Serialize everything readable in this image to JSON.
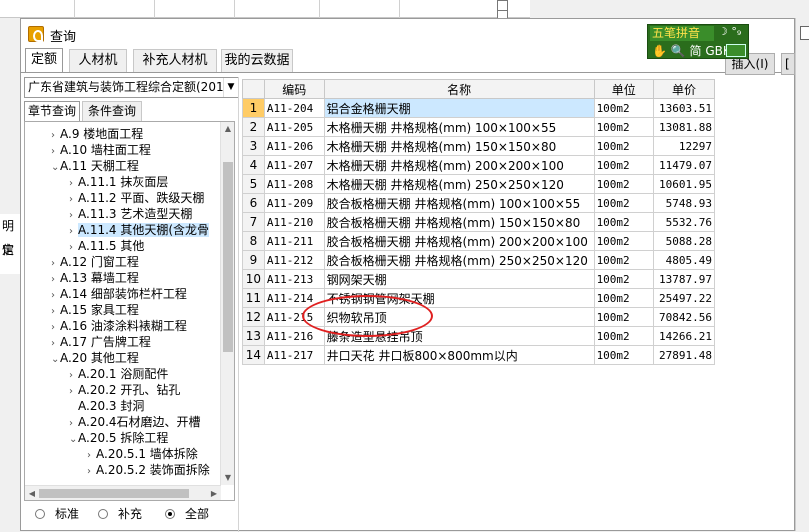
{
  "background": {
    "left_items": [
      "明信",
      "定"
    ]
  },
  "dialog": {
    "title": "查询",
    "tabs": [
      "定额",
      "人材机",
      "补充人材机",
      "我的云数据"
    ],
    "insert_label": "插入(I)",
    "insert_label2": "[",
    "ime": {
      "name": "五笔拼音",
      "moon": "☽ °₉",
      "row2": "✋ 🔍 简 GBK"
    },
    "library": "广东省建筑与装饰工程综合定额(201",
    "subtabs": [
      "章节查询",
      "条件查询"
    ],
    "tree": [
      {
        "label": "A.9 楼地面工程",
        "level": 1,
        "expanded": false
      },
      {
        "label": "A.10 墙柱面工程",
        "level": 1,
        "expanded": false
      },
      {
        "label": "A.11 天棚工程",
        "level": 1,
        "expanded": true
      },
      {
        "label": "A.11.1 抹灰面层",
        "level": 2,
        "expanded": false
      },
      {
        "label": "A.11.2 平面、跌级天棚",
        "level": 2,
        "expanded": false
      },
      {
        "label": "A.11.3 艺术造型天棚",
        "level": 2,
        "expanded": false
      },
      {
        "label": "A.11.4 其他天棚(含龙骨",
        "level": 2,
        "expanded": false,
        "selected": true
      },
      {
        "label": "A.11.5 其他",
        "level": 2,
        "expanded": false
      },
      {
        "label": "A.12 门窗工程",
        "level": 1,
        "expanded": false
      },
      {
        "label": "A.13 幕墙工程",
        "level": 1,
        "expanded": false
      },
      {
        "label": "A.14 细部装饰栏杆工程",
        "level": 1,
        "expanded": false
      },
      {
        "label": "A.15 家具工程",
        "level": 1,
        "expanded": false
      },
      {
        "label": "A.16 油漆涂料裱糊工程",
        "level": 1,
        "expanded": false
      },
      {
        "label": "A.17 广告牌工程",
        "level": 1,
        "expanded": false
      },
      {
        "label": "A.20 其他工程",
        "level": 1,
        "expanded": true
      },
      {
        "label": "A.20.1 浴厕配件",
        "level": 2,
        "expanded": false
      },
      {
        "label": "A.20.2 开孔、钻孔",
        "level": 2,
        "expanded": false
      },
      {
        "label": "A.20.3 封洞",
        "level": 2,
        "expanded": false,
        "leaf": true
      },
      {
        "label": "A.20.4石材磨边、开槽",
        "level": 2,
        "expanded": false
      },
      {
        "label": "A.20.5 拆除工程",
        "level": 2,
        "expanded": true
      },
      {
        "label": "A.20.5.1 墙体拆除",
        "level": 3,
        "expanded": false
      },
      {
        "label": "A.20.5.2 装饰面拆除",
        "level": 3,
        "expanded": false
      }
    ],
    "radios": [
      {
        "label": "标准",
        "checked": false
      },
      {
        "label": "补充",
        "checked": false
      },
      {
        "label": "全部",
        "checked": true
      }
    ],
    "table": {
      "headers": [
        "编码",
        "名称",
        "单位",
        "单价"
      ],
      "rows": [
        {
          "idx": "1",
          "code": "A11-204",
          "name": "铝合金格栅天棚",
          "unit": "100m2",
          "price": "13603.51",
          "selected": true
        },
        {
          "idx": "2",
          "code": "A11-205",
          "name": "木格栅天棚 井格规格(mm) 100×100×55",
          "unit": "100m2",
          "price": "13081.88"
        },
        {
          "idx": "3",
          "code": "A11-206",
          "name": "木格栅天棚 井格规格(mm) 150×150×80",
          "unit": "100m2",
          "price": "12297"
        },
        {
          "idx": "4",
          "code": "A11-207",
          "name": "木格栅天棚 井格规格(mm) 200×200×100",
          "unit": "100m2",
          "price": "11479.07"
        },
        {
          "idx": "5",
          "code": "A11-208",
          "name": "木格栅天棚 井格规格(mm) 250×250×120",
          "unit": "100m2",
          "price": "10601.95"
        },
        {
          "idx": "6",
          "code": "A11-209",
          "name": "胶合板格栅天棚 井格规格(mm) 100×100×55",
          "unit": "100m2",
          "price": "5748.93"
        },
        {
          "idx": "7",
          "code": "A11-210",
          "name": "胶合板格栅天棚 井格规格(mm) 150×150×80",
          "unit": "100m2",
          "price": "5532.76"
        },
        {
          "idx": "8",
          "code": "A11-211",
          "name": "胶合板格栅天棚 井格规格(mm) 200×200×100",
          "unit": "100m2",
          "price": "5088.28"
        },
        {
          "idx": "9",
          "code": "A11-212",
          "name": "胶合板格栅天棚 井格规格(mm) 250×250×120",
          "unit": "100m2",
          "price": "4805.49"
        },
        {
          "idx": "10",
          "code": "A11-213",
          "name": "钢网架天棚",
          "unit": "100m2",
          "price": "13787.97"
        },
        {
          "idx": "11",
          "code": "A11-214",
          "name": "不锈钢钢管网架天棚",
          "unit": "100m2",
          "price": "25497.22"
        },
        {
          "idx": "12",
          "code": "A11-215",
          "name": "织物软吊顶",
          "unit": "100m2",
          "price": "70842.56"
        },
        {
          "idx": "13",
          "code": "A11-216",
          "name": "藤条造型悬挂吊顶",
          "unit": "100m2",
          "price": "14266.21"
        },
        {
          "idx": "14",
          "code": "A11-217",
          "name": "井口天花 井口板800×800mm以内",
          "unit": "100m2",
          "price": "27891.48"
        }
      ]
    }
  },
  "colors": {
    "selection": "#cce8ff",
    "row_marker": "#ffcc66",
    "annotation": "#e02020",
    "ime_bg": "#2a6d1c"
  }
}
